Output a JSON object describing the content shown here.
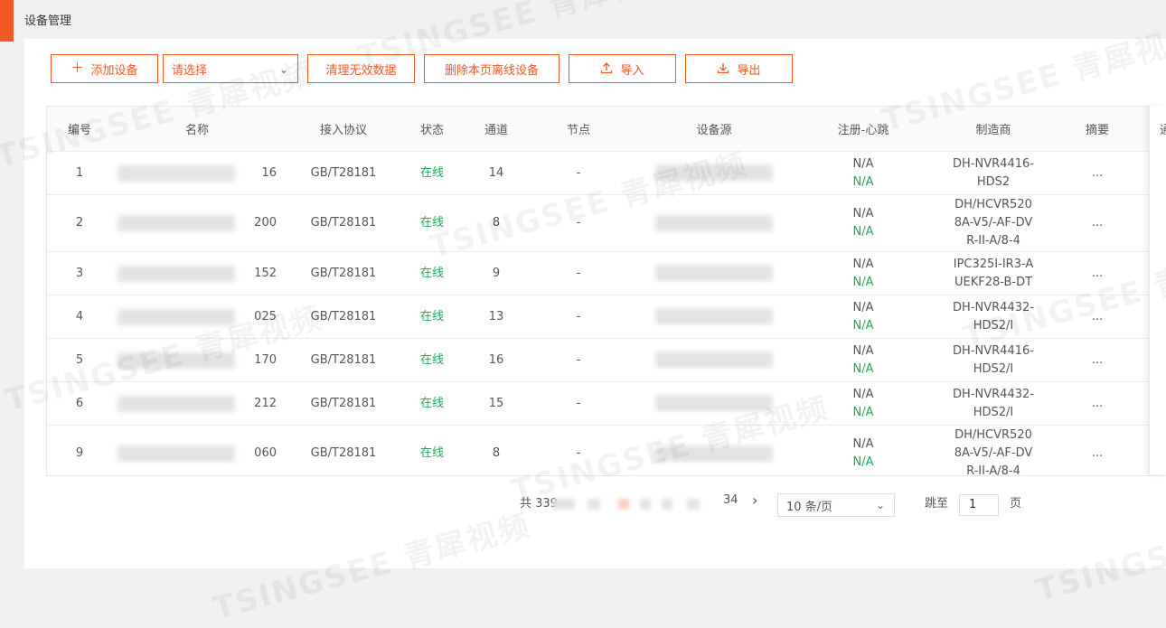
{
  "page": {
    "title": "设备管理"
  },
  "toolbar": {
    "add_label": "添加设备",
    "select_placeholder": "请选择",
    "clear_label": "清理无效数据",
    "delete_offline_label": "删除本页离线设备",
    "import_label": "导入",
    "export_label": "导出"
  },
  "table": {
    "headers": [
      "编号",
      "名称",
      "接入协议",
      "状态",
      "通道",
      "节点",
      "设备源",
      "注册-心跳",
      "制造商",
      "摘要"
    ],
    "rows": [
      {
        "id": "1",
        "name_suffix": "16",
        "protocol": "GB/T28181",
        "status": "在线",
        "channels": "14",
        "node": "-",
        "reg": "N/A",
        "hb": "N/A",
        "maker": [
          "DH-NVR4416-",
          "HDS2"
        ],
        "summary": "..."
      },
      {
        "id": "2",
        "name_suffix": "200",
        "protocol": "GB/T28181",
        "status": "在线",
        "channels": "8",
        "node": "-",
        "reg": "N/A",
        "hb": "N/A",
        "maker": [
          "DH/HCVR520",
          "8A-V5/-AF-DV",
          "R-II-A/8-4"
        ],
        "summary": "..."
      },
      {
        "id": "3",
        "name_suffix": "152",
        "protocol": "GB/T28181",
        "status": "在线",
        "channels": "9",
        "node": "-",
        "reg": "N/A",
        "hb": "N/A",
        "maker": [
          "IPC325I-IR3-A",
          "UEKF28-B-DT"
        ],
        "summary": "..."
      },
      {
        "id": "4",
        "name_suffix": "025",
        "protocol": "GB/T28181",
        "status": "在线",
        "channels": "13",
        "node": "-",
        "reg": "N/A",
        "hb": "N/A",
        "maker": [
          "DH-NVR4432-",
          "HDS2/I"
        ],
        "summary": "..."
      },
      {
        "id": "5",
        "name_suffix": "170",
        "protocol": "GB/T28181",
        "status": "在线",
        "channels": "16",
        "node": "-",
        "reg": "N/A",
        "hb": "N/A",
        "maker": [
          "DH-NVR4416-",
          "HDS2/I"
        ],
        "summary": "..."
      },
      {
        "id": "6",
        "name_suffix": "212",
        "protocol": "GB/T28181",
        "status": "在线",
        "channels": "15",
        "node": "-",
        "reg": "N/A",
        "hb": "N/A",
        "maker": [
          "DH-NVR4432-",
          "HDS2/I"
        ],
        "summary": "..."
      },
      {
        "id": "9",
        "name_suffix": "060",
        "protocol": "GB/T28181",
        "status": "在线",
        "channels": "8",
        "node": "-",
        "reg": "N/A",
        "hb": "N/A",
        "maker": [
          "DH/HCVR520",
          "8A-V5/-AF-DV",
          "R-II-A/8-4"
        ],
        "summary": "..."
      }
    ],
    "cut_header": "通"
  },
  "pagination": {
    "total_prefix": "共 339",
    "last_page": "34",
    "next_icon": "›",
    "page_size": "10 条/页",
    "jump_label": "跳至",
    "jump_value": "1",
    "page_suffix": "页"
  },
  "watermark_text": "TSINGSEE 青犀视频",
  "colors": {
    "accent": "#f15a24",
    "online": "#23a55a"
  }
}
